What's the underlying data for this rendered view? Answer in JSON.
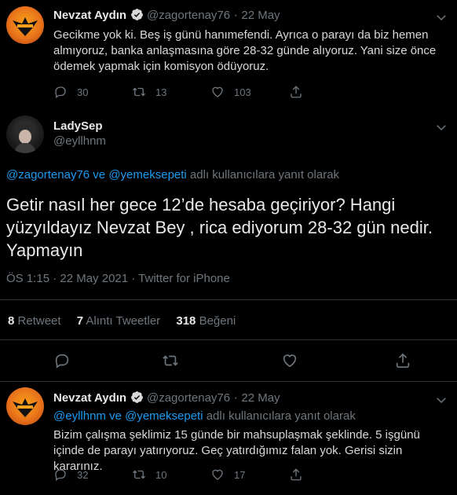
{
  "tweet1": {
    "name": "Nevzat Aydın",
    "handle": "@zagortenay76",
    "dot": "·",
    "date": "22 May",
    "text": "Gecikme yok ki. Beş iş günü hanımefendi. Ayrıca o parayı da biz hemen almıyoruz, banka anlaşmasına göre 28-32 günde alıyoruz. Yani size önce ödemek yapmak için komisyon ödüyoruz.",
    "replies": "30",
    "retweets": "13",
    "likes": "103"
  },
  "main": {
    "name": "LadySep",
    "handle": "@eyllhnm",
    "reply_to_a": "@zagortenay76",
    "reply_to_and": " ve ",
    "reply_to_b": "@yemeksepeti",
    "reply_to_suffix": " adlı kullanıcılara yanıt olarak",
    "text": "Getir nasıl her gece 12’de hesaba geçiriyor? Hangi yüzyıldayız Nevzat Bey , rica ediyorum 28-32 gün nedir. Yapmayın",
    "timestamp": "ÖS 1:15 · 22 May 2021 · Twitter for iPhone",
    "stats": {
      "retweet_count": "8",
      "retweet_label": "Retweet",
      "quote_count": "7",
      "quote_label": "Alıntı Tweetler",
      "like_count": "318",
      "like_label": "Beğeni"
    }
  },
  "tweet3": {
    "name": "Nevzat Aydın",
    "handle": "@zagortenay76",
    "dot": "·",
    "date": "22 May",
    "reply_to_a": "@eyllhnm",
    "reply_to_and": " ve ",
    "reply_to_b": "@yemeksepeti",
    "reply_to_suffix": " adlı kullanıcılara yanıt olarak",
    "text": "Bizim çalışma şeklimiz 15 günde bir mahsuplaşmak şeklinde. 5 işgünü içinde de parayı yatırıyoruz. Geç yatırdığımız falan yok. Gerisi sizin kararınız.",
    "replies": "32",
    "retweets": "10",
    "likes": "17"
  },
  "colors": {
    "background": "#000000",
    "text": "#d9d9d9",
    "muted": "#6e767d",
    "link": "#1d9bf0",
    "border": "#2f3336"
  },
  "icons": [
    "verified-badge-icon",
    "reply-icon",
    "retweet-icon",
    "like-icon",
    "share-icon"
  ]
}
